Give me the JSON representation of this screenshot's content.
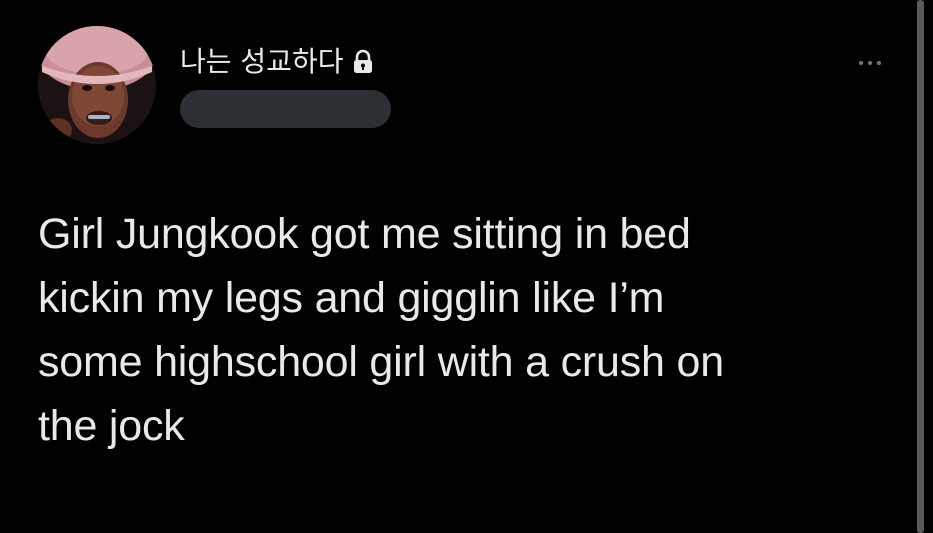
{
  "user": {
    "display_name": "나는 성교하다",
    "handle": "",
    "protected": true
  },
  "tweet": {
    "text": "Girl Jungkook got me sitting in bed\nkickin my legs and gigglin like I’m\nsome highschool girl with a crush on\nthe jock"
  },
  "icons": {
    "lock": "lock-icon",
    "more": "more-horizontal-icon"
  },
  "colors": {
    "background": "#000000",
    "text": "#e7e9ea",
    "muted": "#71767b",
    "redaction": "#2c2f33"
  }
}
